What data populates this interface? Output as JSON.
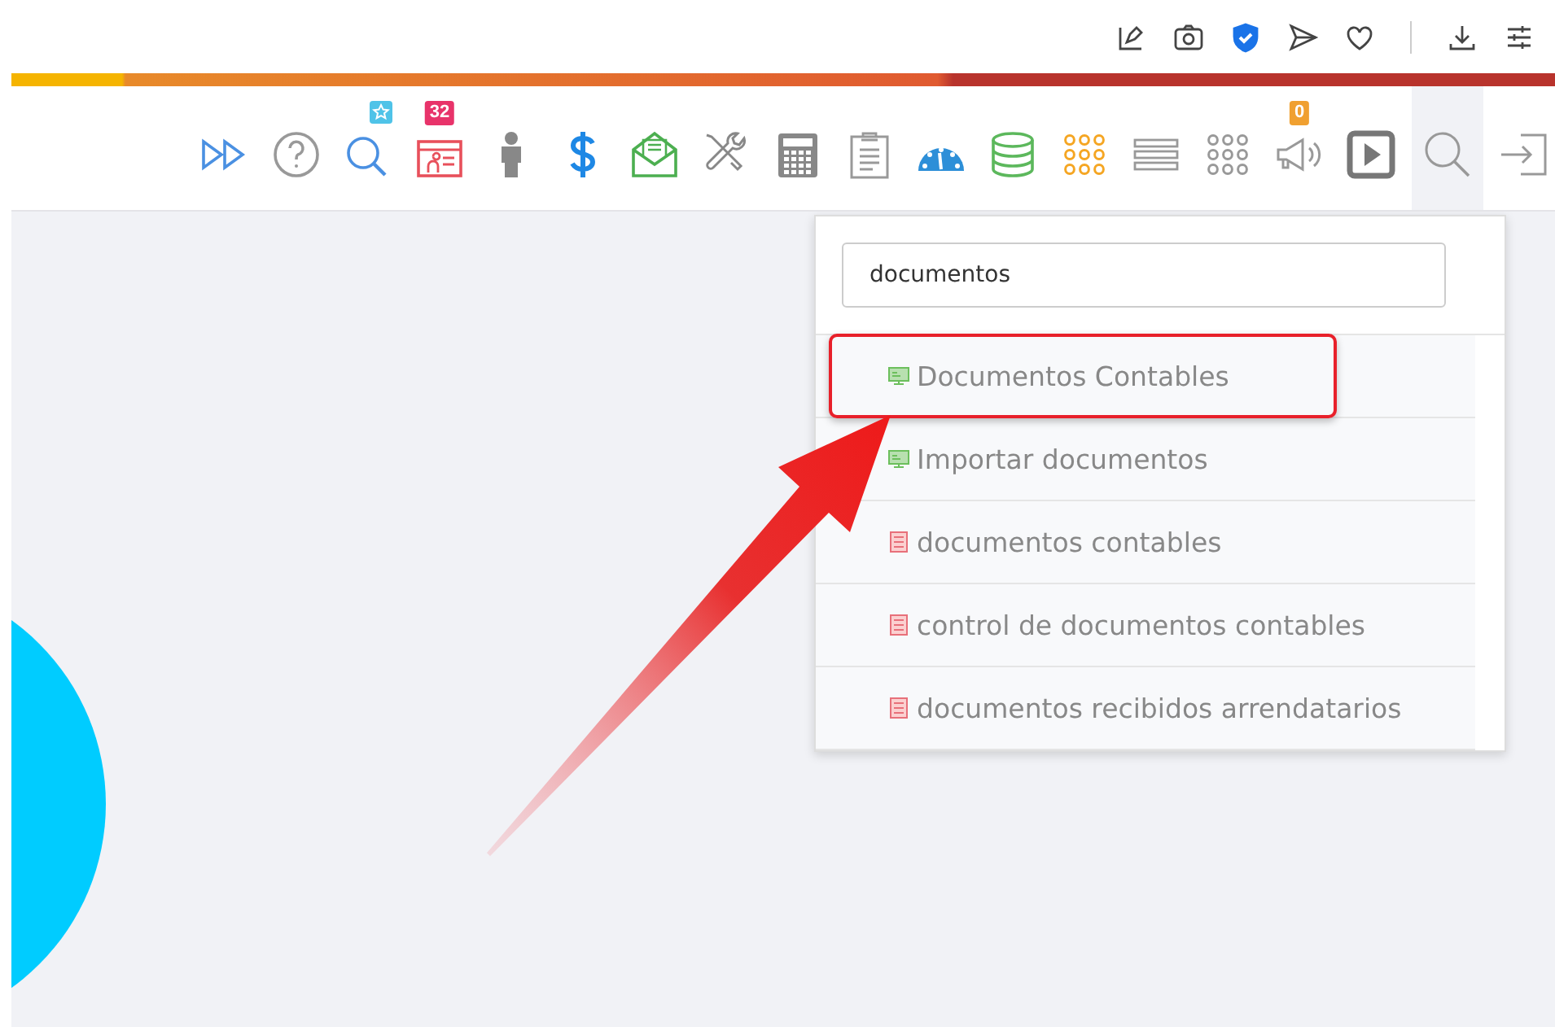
{
  "browser_toolbar": [
    {
      "kind": "pin-edit"
    },
    {
      "kind": "camera"
    },
    {
      "kind": "shield"
    },
    {
      "kind": "send"
    },
    {
      "kind": "heart"
    },
    {
      "kind": "divider"
    },
    {
      "kind": "download"
    },
    {
      "kind": "sliders"
    }
  ],
  "app_toolbar": [
    {
      "kind": "forward",
      "selected": false
    },
    {
      "kind": "help",
      "selected": false
    },
    {
      "kind": "search-star",
      "selected": false
    },
    {
      "kind": "calendar",
      "badge": "32",
      "selected": false
    },
    {
      "kind": "person",
      "selected": false
    },
    {
      "kind": "dollar",
      "selected": false
    },
    {
      "kind": "mail",
      "selected": false
    },
    {
      "kind": "tools",
      "selected": false
    },
    {
      "kind": "calculator",
      "selected": false
    },
    {
      "kind": "clipboard",
      "selected": false
    },
    {
      "kind": "gauge",
      "selected": false
    },
    {
      "kind": "database",
      "selected": false
    },
    {
      "kind": "dots-orange",
      "selected": false
    },
    {
      "kind": "lines",
      "selected": false
    },
    {
      "kind": "dots-gray",
      "selected": false
    },
    {
      "kind": "megaphone",
      "badge": "0",
      "selected": false
    },
    {
      "kind": "play",
      "selected": false
    },
    {
      "kind": "search",
      "selected": true
    },
    {
      "kind": "exit",
      "selected": false
    }
  ],
  "search_dropdown": {
    "query": "documentos",
    "results": [
      {
        "kind": "screen",
        "label": "Documentos Contables",
        "highlighted": true
      },
      {
        "kind": "screen",
        "label": "Importar documentos",
        "highlighted": false
      },
      {
        "kind": "report",
        "label": "documentos contables",
        "highlighted": false
      },
      {
        "kind": "report",
        "label": "control de documentos contables",
        "highlighted": false
      },
      {
        "kind": "report",
        "label": "documentos recibidos arrendatarios",
        "highlighted": false
      }
    ]
  }
}
